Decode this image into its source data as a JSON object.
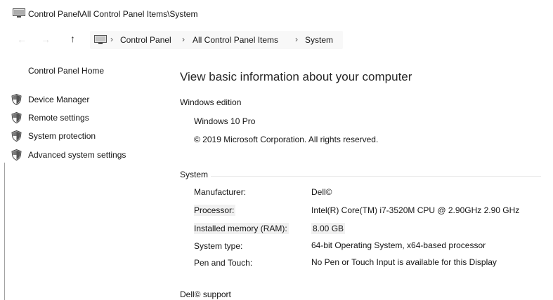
{
  "window": {
    "title": "Control Panel\\All Control Panel Items\\System",
    "icon": "system-window-icon"
  },
  "nav": {
    "back": "←",
    "forward": "→",
    "up": "↑"
  },
  "address_bar": {
    "icon": "computer-icon",
    "separator": "›",
    "crumbs": [
      "Control Panel",
      "All Control Panel Items",
      "System"
    ]
  },
  "left_pane": {
    "home_link": "Control Panel Home",
    "links": [
      {
        "label": "Device Manager",
        "icon": "shield-icon"
      },
      {
        "label": "Remote settings",
        "icon": "shield-icon"
      },
      {
        "label": "System protection",
        "icon": "shield-icon"
      },
      {
        "label": "Advanced system settings",
        "icon": "shield-icon"
      }
    ]
  },
  "main": {
    "heading": "View basic information about your computer",
    "windows_edition": {
      "section_label": "Windows edition",
      "edition": "Windows 10 Pro",
      "copyright": "© 2019 Microsoft Corporation. All rights reserved."
    },
    "system": {
      "section_label": "System",
      "rows": [
        {
          "label": "Manufacturer:",
          "value": "Dell©"
        },
        {
          "label": "Processor:",
          "value": "Intel(R) Core(TM) i7-3520M CPU @ 2.90GHz   2.90 GHz"
        },
        {
          "label": "Installed memory (RAM):",
          "value": "8.00 GB"
        },
        {
          "label": "System type:",
          "value": "64-bit Operating System, x64-based processor"
        },
        {
          "label": "Pen and Touch:",
          "value": "No Pen or Touch Input is available for this Display"
        }
      ]
    },
    "support": {
      "section_label": "Dell© support"
    }
  },
  "colors": {
    "background": "#ffffff",
    "text": "#1a1a1a",
    "address_bar_bg": "#f2f2f2",
    "row_highlight": "#ececec",
    "section_rule": "#e4e4e4"
  }
}
